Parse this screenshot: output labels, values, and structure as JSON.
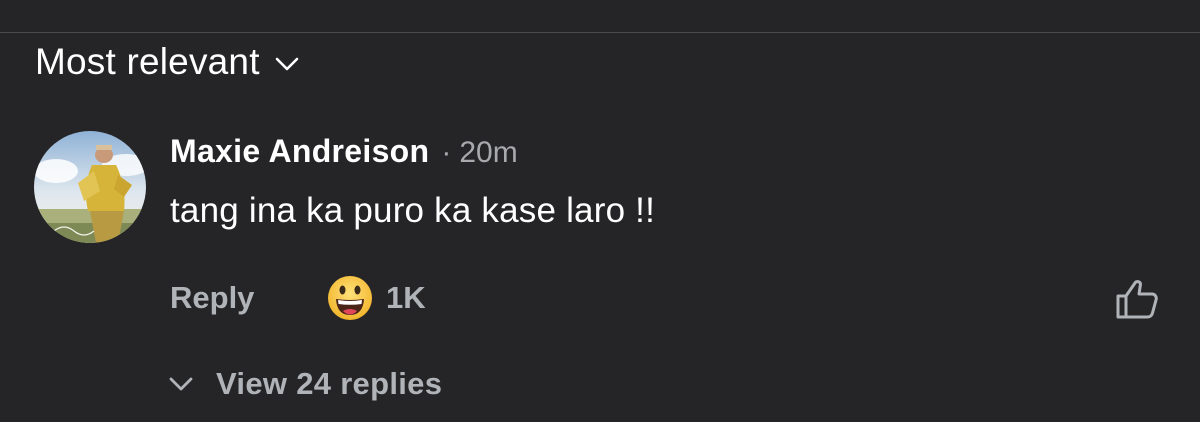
{
  "sort": {
    "label": "Most relevant",
    "icon": "chevron-down-icon"
  },
  "comment": {
    "author": "Maxie Andreison",
    "separator": "·",
    "time": "20m",
    "text": "tang ina ka puro ka kase laro !!",
    "avatar_icon": "profile-photo",
    "actions": {
      "reply_label": "Reply",
      "reaction_icon": "grinning-face-emoji",
      "reaction_count": "1K",
      "like_icon": "thumbs-up-icon"
    },
    "view_replies": {
      "label": "View 24 replies",
      "icon": "chevron-down-icon"
    }
  },
  "colors": {
    "background": "#252527",
    "primary_text": "#ffffff",
    "secondary_text": "#b0b3b8",
    "divider": "#4a4a4d",
    "emoji_yellow": "#f7c53a"
  }
}
